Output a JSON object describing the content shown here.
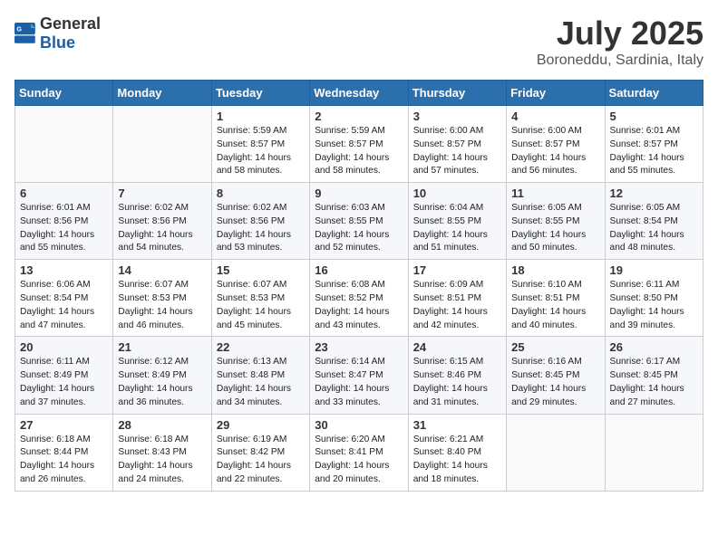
{
  "logo": {
    "general": "General",
    "blue": "Blue"
  },
  "header": {
    "month_year": "July 2025",
    "location": "Boroneddu, Sardinia, Italy"
  },
  "days_of_week": [
    "Sunday",
    "Monday",
    "Tuesday",
    "Wednesday",
    "Thursday",
    "Friday",
    "Saturday"
  ],
  "weeks": [
    [
      {
        "day": "",
        "empty": true
      },
      {
        "day": "",
        "empty": true
      },
      {
        "day": "1",
        "sunrise": "5:59 AM",
        "sunset": "8:57 PM",
        "daylight": "14 hours and 58 minutes."
      },
      {
        "day": "2",
        "sunrise": "5:59 AM",
        "sunset": "8:57 PM",
        "daylight": "14 hours and 58 minutes."
      },
      {
        "day": "3",
        "sunrise": "6:00 AM",
        "sunset": "8:57 PM",
        "daylight": "14 hours and 57 minutes."
      },
      {
        "day": "4",
        "sunrise": "6:00 AM",
        "sunset": "8:57 PM",
        "daylight": "14 hours and 56 minutes."
      },
      {
        "day": "5",
        "sunrise": "6:01 AM",
        "sunset": "8:57 PM",
        "daylight": "14 hours and 55 minutes."
      }
    ],
    [
      {
        "day": "6",
        "sunrise": "6:01 AM",
        "sunset": "8:56 PM",
        "daylight": "14 hours and 55 minutes."
      },
      {
        "day": "7",
        "sunrise": "6:02 AM",
        "sunset": "8:56 PM",
        "daylight": "14 hours and 54 minutes."
      },
      {
        "day": "8",
        "sunrise": "6:02 AM",
        "sunset": "8:56 PM",
        "daylight": "14 hours and 53 minutes."
      },
      {
        "day": "9",
        "sunrise": "6:03 AM",
        "sunset": "8:55 PM",
        "daylight": "14 hours and 52 minutes."
      },
      {
        "day": "10",
        "sunrise": "6:04 AM",
        "sunset": "8:55 PM",
        "daylight": "14 hours and 51 minutes."
      },
      {
        "day": "11",
        "sunrise": "6:05 AM",
        "sunset": "8:55 PM",
        "daylight": "14 hours and 50 minutes."
      },
      {
        "day": "12",
        "sunrise": "6:05 AM",
        "sunset": "8:54 PM",
        "daylight": "14 hours and 48 minutes."
      }
    ],
    [
      {
        "day": "13",
        "sunrise": "6:06 AM",
        "sunset": "8:54 PM",
        "daylight": "14 hours and 47 minutes."
      },
      {
        "day": "14",
        "sunrise": "6:07 AM",
        "sunset": "8:53 PM",
        "daylight": "14 hours and 46 minutes."
      },
      {
        "day": "15",
        "sunrise": "6:07 AM",
        "sunset": "8:53 PM",
        "daylight": "14 hours and 45 minutes."
      },
      {
        "day": "16",
        "sunrise": "6:08 AM",
        "sunset": "8:52 PM",
        "daylight": "14 hours and 43 minutes."
      },
      {
        "day": "17",
        "sunrise": "6:09 AM",
        "sunset": "8:51 PM",
        "daylight": "14 hours and 42 minutes."
      },
      {
        "day": "18",
        "sunrise": "6:10 AM",
        "sunset": "8:51 PM",
        "daylight": "14 hours and 40 minutes."
      },
      {
        "day": "19",
        "sunrise": "6:11 AM",
        "sunset": "8:50 PM",
        "daylight": "14 hours and 39 minutes."
      }
    ],
    [
      {
        "day": "20",
        "sunrise": "6:11 AM",
        "sunset": "8:49 PM",
        "daylight": "14 hours and 37 minutes."
      },
      {
        "day": "21",
        "sunrise": "6:12 AM",
        "sunset": "8:49 PM",
        "daylight": "14 hours and 36 minutes."
      },
      {
        "day": "22",
        "sunrise": "6:13 AM",
        "sunset": "8:48 PM",
        "daylight": "14 hours and 34 minutes."
      },
      {
        "day": "23",
        "sunrise": "6:14 AM",
        "sunset": "8:47 PM",
        "daylight": "14 hours and 33 minutes."
      },
      {
        "day": "24",
        "sunrise": "6:15 AM",
        "sunset": "8:46 PM",
        "daylight": "14 hours and 31 minutes."
      },
      {
        "day": "25",
        "sunrise": "6:16 AM",
        "sunset": "8:45 PM",
        "daylight": "14 hours and 29 minutes."
      },
      {
        "day": "26",
        "sunrise": "6:17 AM",
        "sunset": "8:45 PM",
        "daylight": "14 hours and 27 minutes."
      }
    ],
    [
      {
        "day": "27",
        "sunrise": "6:18 AM",
        "sunset": "8:44 PM",
        "daylight": "14 hours and 26 minutes."
      },
      {
        "day": "28",
        "sunrise": "6:18 AM",
        "sunset": "8:43 PM",
        "daylight": "14 hours and 24 minutes."
      },
      {
        "day": "29",
        "sunrise": "6:19 AM",
        "sunset": "8:42 PM",
        "daylight": "14 hours and 22 minutes."
      },
      {
        "day": "30",
        "sunrise": "6:20 AM",
        "sunset": "8:41 PM",
        "daylight": "14 hours and 20 minutes."
      },
      {
        "day": "31",
        "sunrise": "6:21 AM",
        "sunset": "8:40 PM",
        "daylight": "14 hours and 18 minutes."
      },
      {
        "day": "",
        "empty": true
      },
      {
        "day": "",
        "empty": true
      }
    ]
  ]
}
